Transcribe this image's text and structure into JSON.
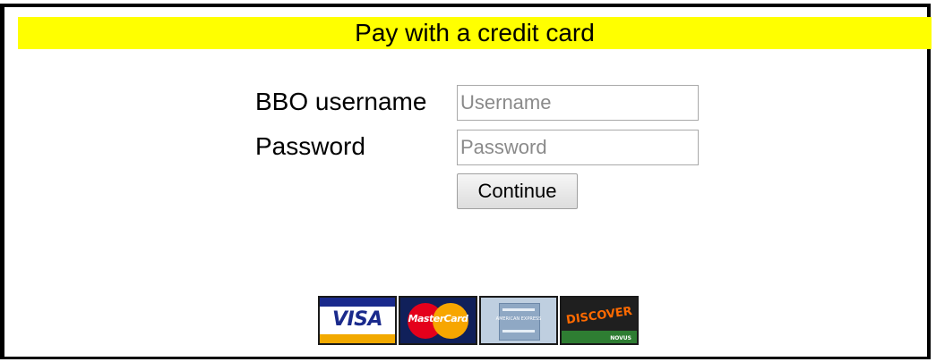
{
  "page": {
    "title": "Pay with a credit card",
    "accent_color": "#ffff00"
  },
  "form": {
    "username_label": "BBO username",
    "username_placeholder": "Username",
    "username_value": "",
    "password_label": "Password",
    "password_placeholder": "Password",
    "password_value": "",
    "continue_label": "Continue"
  },
  "cards": {
    "visa_text": "VISA",
    "mastercard_text": "MasterCard",
    "amex_text": "AMERICAN EXPRESS",
    "discover_text": "DISCOVER",
    "discover_sub": "NOVUS",
    "icons": [
      "visa-logo",
      "mastercard-logo",
      "amex-logo",
      "discover-logo"
    ]
  }
}
